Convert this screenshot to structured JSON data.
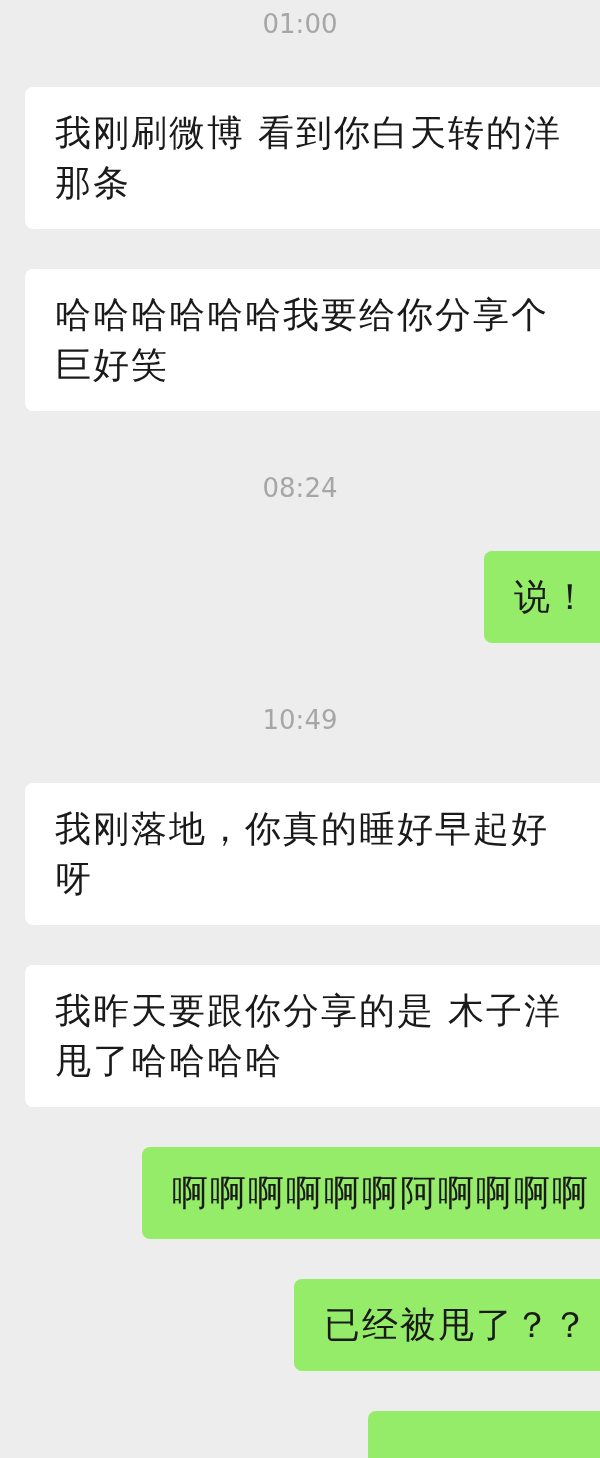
{
  "messages": [
    {
      "kind": "time",
      "text": "01:00"
    },
    {
      "kind": "incoming",
      "lines": [
        "我刚刷微博 看到你白天转的洋",
        "那条"
      ]
    },
    {
      "kind": "incoming",
      "lines": [
        "哈哈哈哈哈哈我要给你分享个",
        "巨好笑"
      ]
    },
    {
      "kind": "time",
      "text": "08:24"
    },
    {
      "kind": "outgoing",
      "lines": [
        "说！"
      ]
    },
    {
      "kind": "time",
      "text": "10:49"
    },
    {
      "kind": "incoming",
      "lines": [
        "我刚落地，你真的睡好早起好",
        "呀"
      ]
    },
    {
      "kind": "incoming",
      "lines": [
        "我昨天要跟你分享的是 木子洋",
        "甩了哈哈哈哈"
      ]
    },
    {
      "kind": "outgoing",
      "lines": [
        "啊啊啊啊啊啊阿啊啊啊啊"
      ]
    },
    {
      "kind": "outgoing",
      "lines": [
        "已经被甩了？？"
      ]
    },
    {
      "kind": "outgoing-cut"
    }
  ]
}
